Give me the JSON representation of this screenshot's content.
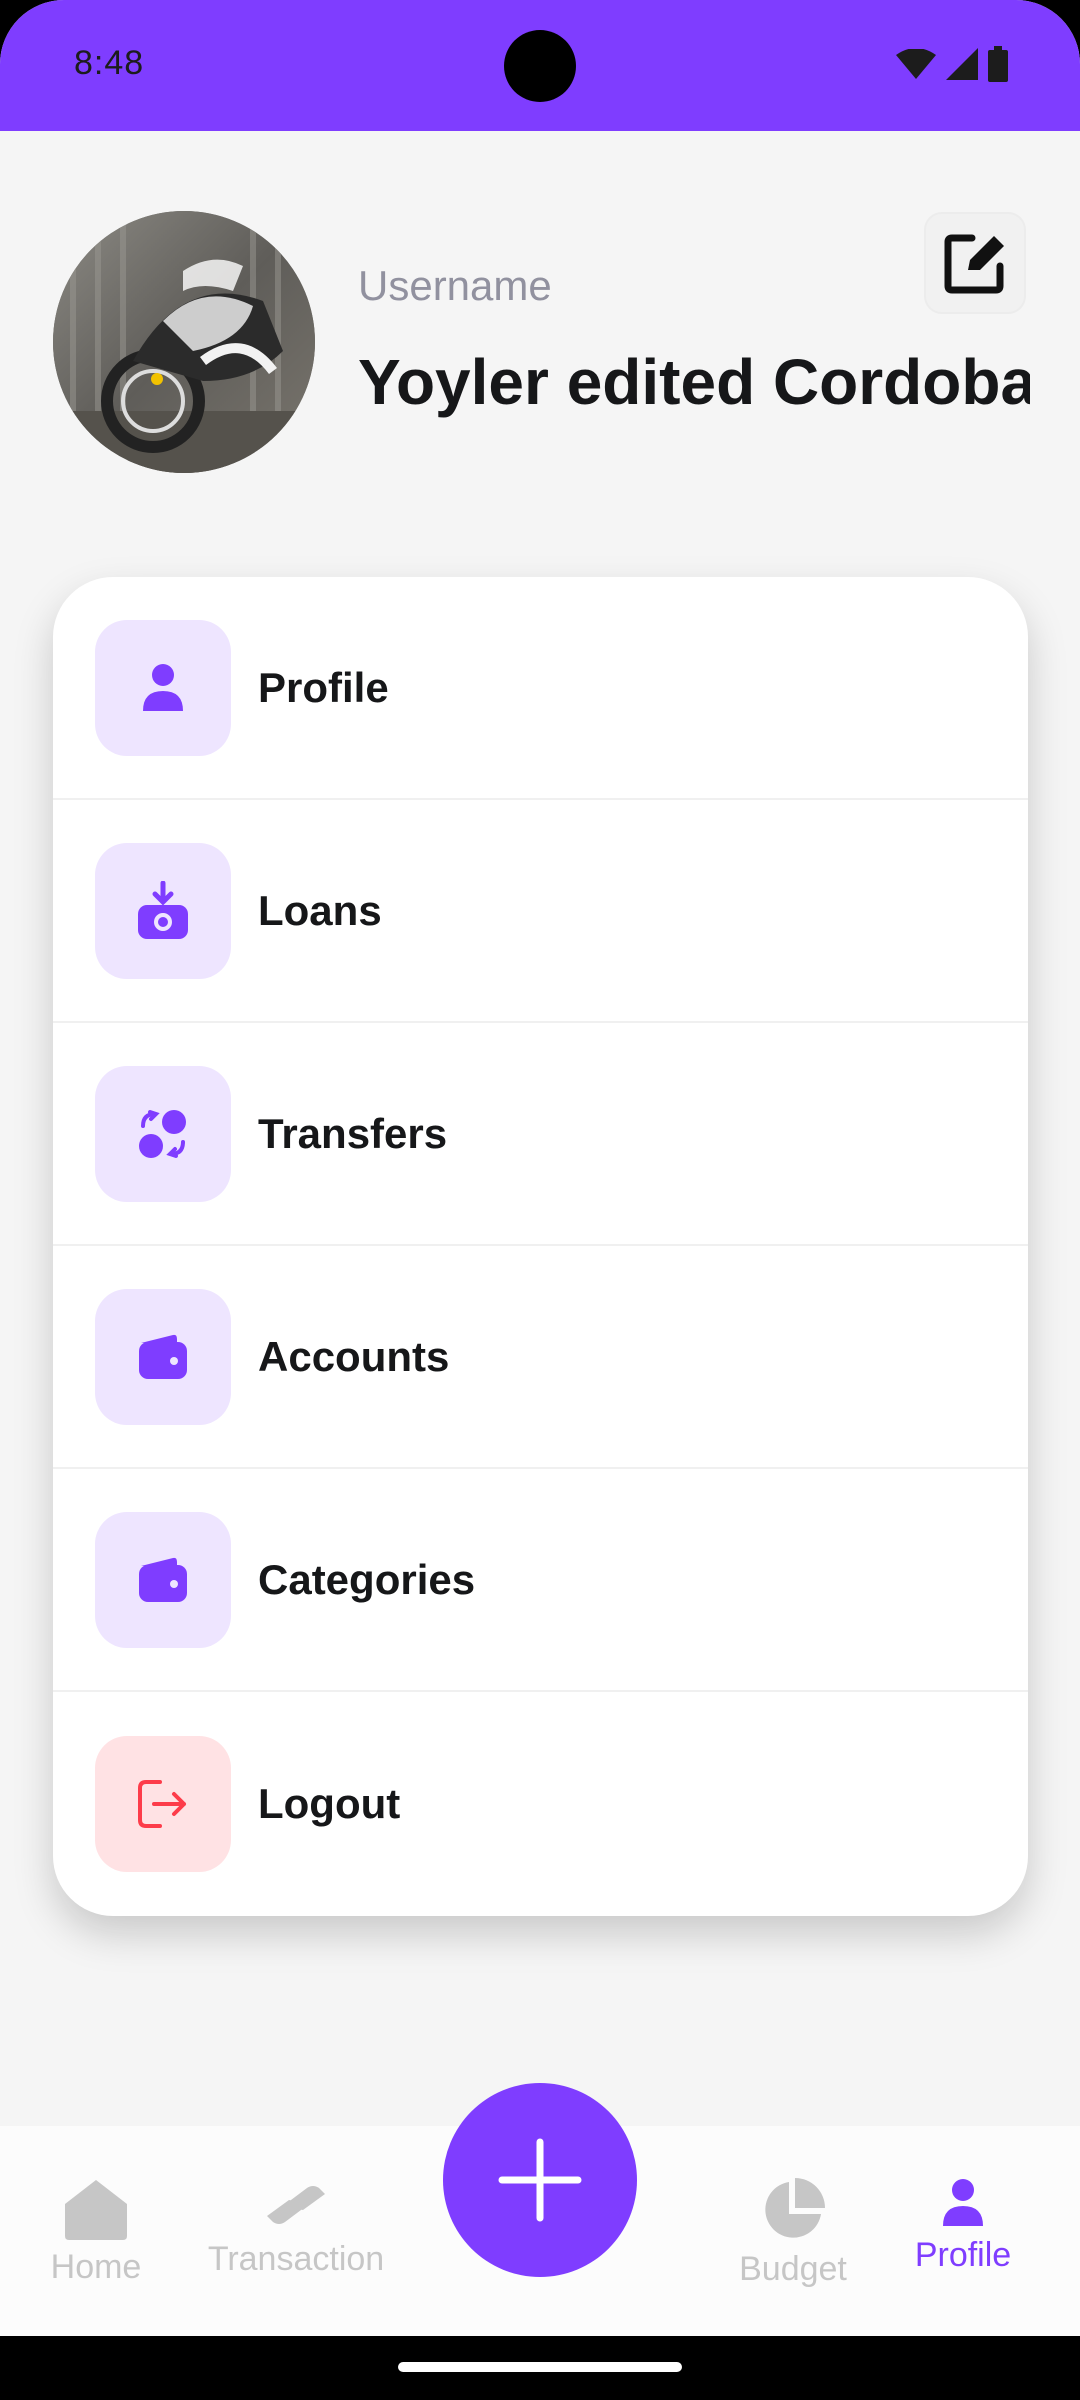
{
  "status_bar": {
    "time": "8:48",
    "icons": [
      "wifi-icon",
      "signal-icon",
      "battery-icon"
    ]
  },
  "header": {
    "avatar": "avatar-photo",
    "username_label": "Username",
    "username_value": "Yoyler edited Cordoba",
    "edit_icon": "edit-icon"
  },
  "menu": {
    "items": [
      {
        "label": "Profile",
        "icon": "person-icon"
      },
      {
        "label": "Loans",
        "icon": "download-wallet-icon"
      },
      {
        "label": "Transfers",
        "icon": "transfer-icon"
      },
      {
        "label": "Accounts",
        "icon": "wallet-icon"
      },
      {
        "label": "Categories",
        "icon": "wallet-icon"
      },
      {
        "label": "Logout",
        "icon": "logout-icon"
      }
    ]
  },
  "bottom_nav": {
    "items": [
      {
        "label": "Home",
        "icon": "home-icon"
      },
      {
        "label": "Transaction",
        "icon": "transaction-icon"
      },
      {
        "label": "Budget",
        "icon": "pie-chart-icon"
      },
      {
        "label": "Profile",
        "icon": "person-icon",
        "active": true
      }
    ],
    "fab_icon": "plus-icon"
  },
  "colors": {
    "accent": "#7f3dff",
    "accent_light": "#eee5ff",
    "danger": "#fd3c4a",
    "danger_light": "#ffe2e4",
    "inactive": "#c6c6c6"
  }
}
